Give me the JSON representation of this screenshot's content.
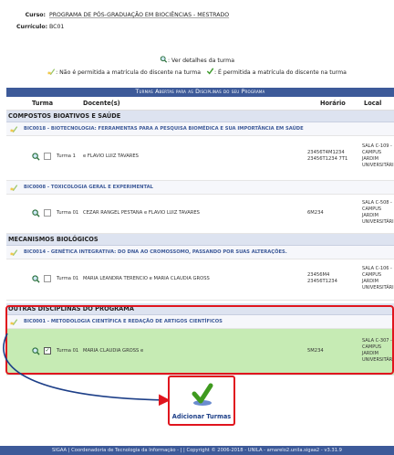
{
  "header": {
    "curso_label": "Curso:",
    "curso_value": "PROGRAMA DE PÓS-GRADUAÇÃO EM BIOCIÊNCIAS - MESTRADO",
    "curriculo_label": "Currículo:",
    "curriculo_value": "BC01"
  },
  "legend": {
    "ver_detalhes": ": Ver detalhes da turma",
    "nao_permitida": ": Não é permitida a matrícula do discente na turma",
    "permitida": ": É permitida a matrícula do discente na turma"
  },
  "table": {
    "title": "Turmas Abertas para as Disciplinas do seu Programa",
    "columns": {
      "turma": "Turma",
      "docente": "Docente(s)",
      "horario": "Horário",
      "local": "Local"
    },
    "groups": [
      {
        "name": "COMPOSTOS BIOATIVOS E SAÚDE",
        "disciplinas": [
          {
            "title": "BIC0018 - BIOTECNOLOGIA: FERRAMENTAS PARA A PESQUISA BIOMÉDICA E SUA IMPORTÂNCIA EM SAÚDE",
            "turma": "Turma 1",
            "docente": "e FLAVIO LUIZ TAVARES",
            "horario": [
              "23456T4M1234",
              "23456T1234 7T1"
            ],
            "local": [
              "SALA C-109 -",
              "CAMPUS",
              "JARDIM",
              "UNIVERSITÁRI"
            ]
          },
          {
            "title": "BIC0008 - TOXICOLOGIA GERAL E EXPERIMENTAL",
            "turma": "Turma 01",
            "docente": "CEZAR RANGEL PESTANA e FLAVIO LUIZ TAVARES",
            "horario": [
              "6M234"
            ],
            "local": [
              "SALA C-508 -",
              "CAMPUS",
              "JARDIM",
              "UNIVERSITÁRI"
            ]
          }
        ]
      },
      {
        "name": "MECANISMOS BIOLÓGICOS",
        "disciplinas": [
          {
            "title": "BIC0014 - GENÉTICA INTEGRATIVA: DO DNA AO CROMOSSOMO, PASSANDO POR SUAS ALTERAÇÕES.",
            "turma": "Turma 01",
            "docente": "MARIA LEANDRA TERENCIO e MARIA CLAUDIA GROSS",
            "horario": [
              "23456M4",
              "23456T1234"
            ],
            "local": [
              "SALA C-106 -",
              "CAMPUS",
              "JARDIM",
              "UNIVERSITÁRI"
            ]
          }
        ]
      },
      {
        "name": "OUTRAS DISCIPLINAS DO PROGRAMA",
        "disciplinas": [
          {
            "title": "BIC0001 - METODOLOGIA CIENTÍFICA E REDAÇÃO DE ARTIGOS CIENTÍFICOS",
            "turma": "Turma 01",
            "docente": "MARIA CLAUDIA GROSS e",
            "horario": [
              "5M234"
            ],
            "local": [
              "SALA C-307 -",
              "CAMPUS",
              "JARDIM",
              "UNIVERSITÁRI"
            ]
          }
        ]
      }
    ]
  },
  "add_button": {
    "label": "Adicionar Turmas"
  },
  "footer": "SIGAA | Coordenadoria de Tecnologia da Informação - | | Copyright © 2006-2018 - UNILA - amarelo2.unila.sigaa2 - v3.31.9",
  "colors": {
    "accent": "#3d5a99",
    "highlight_green": "#c6ebb4",
    "annotation_red": "#e0151e"
  }
}
